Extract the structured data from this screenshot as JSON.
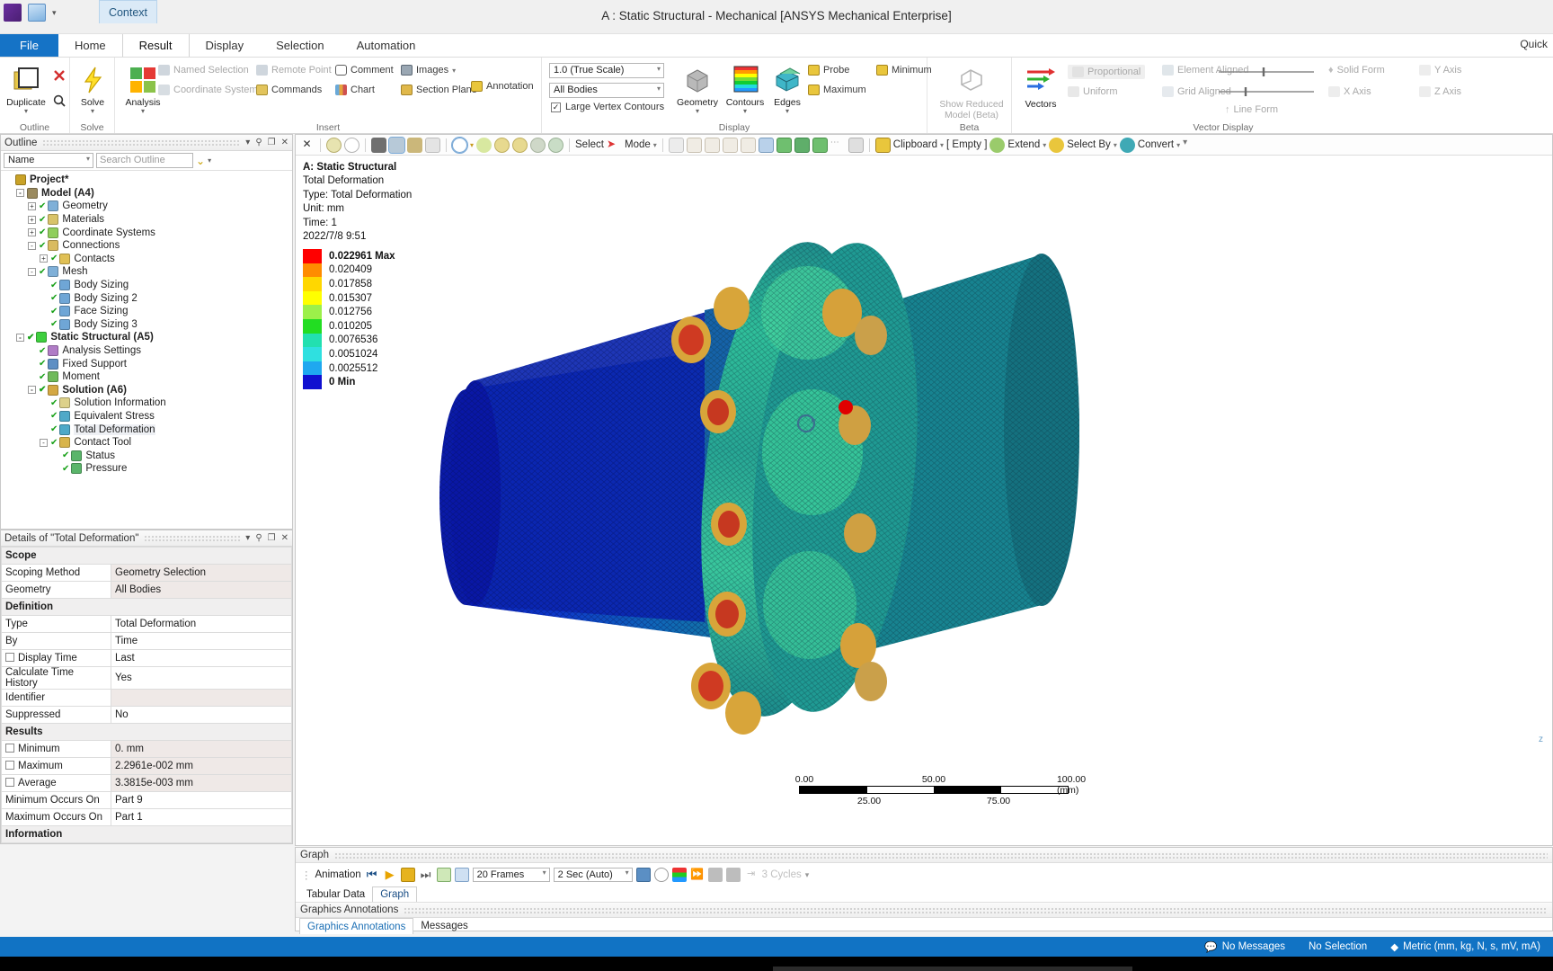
{
  "window": {
    "title": "A : Static Structural - Mechanical [ANSYS Mechanical Enterprise]",
    "quick_access": {
      "app_icon": "ansys-icon",
      "save_icon": "save-icon",
      "more_icon": "chevron-down-icon"
    },
    "context_tab": "Context",
    "quick_right": "Quick"
  },
  "ribbon": {
    "tabs": [
      {
        "label": "File",
        "active": false,
        "kind": "file"
      },
      {
        "label": "Home",
        "active": false
      },
      {
        "label": "Result",
        "active": true
      },
      {
        "label": "Display",
        "active": false
      },
      {
        "label": "Selection",
        "active": false
      },
      {
        "label": "Automation",
        "active": false
      }
    ],
    "groups": {
      "outline": {
        "label": "Outline",
        "duplicate": "Duplicate",
        "delete_icon": "delete-x-icon",
        "find_icon": "search-icon"
      },
      "solve": {
        "label": "Solve",
        "button": "Solve"
      },
      "insert": {
        "label": "Insert",
        "analysis": "Analysis",
        "items": [
          {
            "label": "Named Selection",
            "dim": true,
            "icon": "named-selection-icon"
          },
          {
            "label": "Coordinate System",
            "dim": true,
            "icon": "coordinate-system-icon"
          },
          {
            "label": "Remote Point",
            "dim": true,
            "icon": "remote-point-icon"
          },
          {
            "label": "Commands",
            "dim": false,
            "icon": "commands-icon"
          },
          {
            "label": "Comment",
            "dim": false,
            "icon": "comment-icon"
          },
          {
            "label": "Chart",
            "dim": false,
            "icon": "chart-icon"
          },
          {
            "label": "Images",
            "dim": false,
            "icon": "images-icon"
          },
          {
            "label": "Section Plane",
            "dim": false,
            "icon": "section-plane-icon"
          },
          {
            "label": "Annotation",
            "dim": false,
            "icon": "annotation-icon"
          }
        ]
      },
      "display": {
        "label": "Display",
        "scale_combo": "1.0 (True Scale)",
        "bodies_combo": "All Bodies",
        "large_vertex_contours": "Large Vertex Contours",
        "large_vertex_checked": "✓",
        "geometry": "Geometry",
        "contours": "Contours",
        "edges": "Edges",
        "probe": "Probe",
        "maximum": "Maximum",
        "minimum": "Minimum"
      },
      "beta": {
        "label": "Beta",
        "show_reduced": "Show Reduced\nModel (Beta)",
        "line1": "Show Reduced",
        "line2": "Model (Beta)"
      },
      "vector_display": {
        "label": "Vector Display",
        "vectors": "Vectors",
        "proportional": "Proportional",
        "uniform": "Uniform",
        "element_aligned": "Element Aligned",
        "grid_aligned": "Grid Aligned",
        "line_form": "Line Form",
        "solid_form": "Solid Form",
        "x_axis": "X Axis",
        "y_axis": "Y Axis",
        "z_axis": "Z Axis"
      }
    }
  },
  "outline": {
    "title": "Outline",
    "filter_select": "Name",
    "search_placeholder": "Search Outline",
    "tree": [
      {
        "label": "Project*",
        "depth": 0,
        "exp": "",
        "tick": false,
        "bold": true,
        "icon": "project-icon",
        "color": "#c9a227"
      },
      {
        "label": "Model (A4)",
        "depth": 1,
        "exp": "-",
        "tick": false,
        "bold": true,
        "icon": "model-icon",
        "color": "#9a8a5e"
      },
      {
        "label": "Geometry",
        "depth": 2,
        "exp": "+",
        "tick": true,
        "icon": "geometry-icon",
        "color": "#7fb0d8"
      },
      {
        "label": "Materials",
        "depth": 2,
        "exp": "+",
        "tick": true,
        "icon": "materials-icon",
        "color": "#d8c36a"
      },
      {
        "label": "Coordinate Systems",
        "depth": 2,
        "exp": "+",
        "tick": true,
        "icon": "coordinate-system-icon",
        "color": "#8fce5c"
      },
      {
        "label": "Connections",
        "depth": 2,
        "exp": "-",
        "tick": true,
        "icon": "connections-icon",
        "color": "#d9bb60"
      },
      {
        "label": "Contacts",
        "depth": 3,
        "exp": "+",
        "tick": true,
        "icon": "contacts-icon",
        "color": "#e0c055"
      },
      {
        "label": "Mesh",
        "depth": 2,
        "exp": "-",
        "tick": true,
        "icon": "mesh-icon",
        "color": "#7fb0d8"
      },
      {
        "label": "Body Sizing",
        "depth": 3,
        "exp": "",
        "tick": true,
        "icon": "sizing-icon",
        "color": "#6fa6d6"
      },
      {
        "label": "Body Sizing 2",
        "depth": 3,
        "exp": "",
        "tick": true,
        "icon": "sizing-icon",
        "color": "#6fa6d6"
      },
      {
        "label": "Face Sizing",
        "depth": 3,
        "exp": "",
        "tick": true,
        "icon": "sizing-icon",
        "color": "#6fa6d6"
      },
      {
        "label": "Body Sizing 3",
        "depth": 3,
        "exp": "",
        "tick": true,
        "icon": "sizing-icon",
        "color": "#6fa6d6"
      },
      {
        "label": "Static Structural (A5)",
        "depth": 1,
        "exp": "-",
        "tick": true,
        "bold": true,
        "icon": "static-structural-icon",
        "color": "#3ecf3e"
      },
      {
        "label": "Analysis Settings",
        "depth": 2,
        "exp": "",
        "tick": true,
        "icon": "analysis-settings-icon",
        "color": "#b07cc6"
      },
      {
        "label": "Fixed Support",
        "depth": 2,
        "exp": "",
        "tick": true,
        "icon": "fixed-support-icon",
        "color": "#5e8fc4"
      },
      {
        "label": "Moment",
        "depth": 2,
        "exp": "",
        "tick": true,
        "icon": "moment-icon",
        "color": "#6fba5a"
      },
      {
        "label": "Solution (A6)",
        "depth": 2,
        "exp": "-",
        "tick": true,
        "bold": true,
        "icon": "solution-icon",
        "color": "#d4a843"
      },
      {
        "label": "Solution Information",
        "depth": 3,
        "exp": "",
        "tick": true,
        "icon": "solution-information-icon",
        "color": "#ddd18a"
      },
      {
        "label": "Equivalent Stress",
        "depth": 3,
        "exp": "",
        "tick": true,
        "icon": "result-icon",
        "color": "#4fa9c8"
      },
      {
        "label": "Total Deformation",
        "depth": 3,
        "exp": "",
        "tick": true,
        "icon": "result-icon",
        "color": "#4fa9c8",
        "selected": true
      },
      {
        "label": "Contact Tool",
        "depth": 3,
        "exp": "-",
        "tick": true,
        "icon": "contact-tool-icon",
        "color": "#d8b44a"
      },
      {
        "label": "Status",
        "depth": 4,
        "exp": "",
        "tick": true,
        "icon": "result-icon",
        "color": "#5ab56a"
      },
      {
        "label": "Pressure",
        "depth": 4,
        "exp": "",
        "tick": true,
        "icon": "result-icon",
        "color": "#5ab56a"
      }
    ]
  },
  "details": {
    "title": "Details of \"Total Deformation\"",
    "rows": [
      {
        "type": "section",
        "label": "Scope"
      },
      {
        "type": "row",
        "key": "Scoping Method",
        "value": "Geometry Selection"
      },
      {
        "type": "row",
        "key": "Geometry",
        "value": "All Bodies"
      },
      {
        "type": "section",
        "label": "Definition"
      },
      {
        "type": "row",
        "key": "Type",
        "value": "Total Deformation",
        "white": true
      },
      {
        "type": "row",
        "key": "By",
        "value": "Time",
        "white": true
      },
      {
        "type": "row",
        "key": "Display Time",
        "value": "Last",
        "checkbox": true,
        "white": true
      },
      {
        "type": "row",
        "key": "Calculate Time History",
        "value": "Yes",
        "white": true
      },
      {
        "type": "row",
        "key": "Identifier",
        "value": ""
      },
      {
        "type": "row",
        "key": "Suppressed",
        "value": "No",
        "white": true
      },
      {
        "type": "section",
        "label": "Results"
      },
      {
        "type": "row",
        "key": "Minimum",
        "value": "0. mm",
        "checkbox": true
      },
      {
        "type": "row",
        "key": "Maximum",
        "value": "2.2961e-002 mm",
        "checkbox": true
      },
      {
        "type": "row",
        "key": "Average",
        "value": "3.3815e-003 mm",
        "checkbox": true
      },
      {
        "type": "row",
        "key": "Minimum Occurs On",
        "value": "Part 9",
        "white": true
      },
      {
        "type": "row",
        "key": "Maximum Occurs On",
        "value": "Part 1",
        "white": true
      },
      {
        "type": "section",
        "label": "Information"
      }
    ]
  },
  "graphics_toolbar": {
    "select_label": "Select",
    "mode_label": "Mode",
    "clipboard_label": "Clipboard",
    "empty_label": "[ Empty ]",
    "extend_label": "Extend",
    "select_by_label": "Select By",
    "convert_label": "Convert"
  },
  "result": {
    "header_title": "A: Static Structural",
    "subtitle": "Total Deformation",
    "type_line": "Type: Total Deformation",
    "unit_line": "Unit: mm",
    "time_line": "Time: 1",
    "timestamp": "2022/7/8 9:51",
    "legend": [
      {
        "value": "0.022961 Max",
        "color": "#ff0000",
        "bold": true
      },
      {
        "value": "0.020409",
        "color": "#ff8c00"
      },
      {
        "value": "0.017858",
        "color": "#ffd700"
      },
      {
        "value": "0.015307",
        "color": "#ffff00"
      },
      {
        "value": "0.012756",
        "color": "#9cf04a"
      },
      {
        "value": "0.010205",
        "color": "#22dd22"
      },
      {
        "value": "0.0076536",
        "color": "#22e0b0"
      },
      {
        "value": "0.0051024",
        "color": "#2fe0e0"
      },
      {
        "value": "0.0025512",
        "color": "#1fa8f0"
      },
      {
        "value": "0 Min",
        "color": "#1010d0",
        "bold": true
      }
    ],
    "scale_bar": {
      "top_labels": [
        "0.00",
        "50.00",
        "100.00 (mm)"
      ],
      "bottom_labels": [
        "25.00",
        "75.00"
      ]
    },
    "axis_label": "z"
  },
  "graph_pane": {
    "title": "Graph",
    "animation_label": "Animation",
    "frames": "20 Frames",
    "duration": "2 Sec (Auto)",
    "cycles": "3 Cycles",
    "tabs": [
      {
        "label": "Tabular Data",
        "active": false
      },
      {
        "label": "Graph",
        "active": true
      }
    ]
  },
  "annotations": {
    "title": "Graphics Annotations",
    "tabs": [
      {
        "label": "Graphics Annotations",
        "active": true
      },
      {
        "label": "Messages",
        "active": false
      }
    ]
  },
  "status_bar": {
    "messages": "No Messages",
    "selection": "No Selection",
    "units": "Metric (mm, kg, N, s, mV, mA)",
    "messages_icon": "messages-icon",
    "units_icon": "units-icon"
  }
}
